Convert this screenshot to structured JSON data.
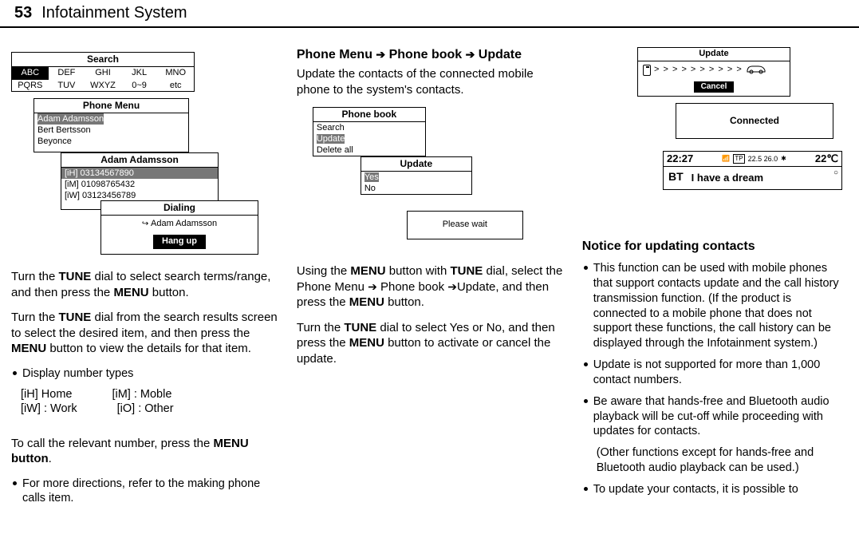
{
  "header": {
    "page_number": "53",
    "section_title": "Infotainment System"
  },
  "col1": {
    "search_screen": {
      "title": "Search",
      "row1": [
        "ABC",
        "DEF",
        "GHI",
        "JKL",
        "MNO"
      ],
      "row2": [
        "PQRS",
        "TUV",
        "WXYZ",
        "0~9",
        "etc"
      ]
    },
    "phone_menu_screen": {
      "title": "Phone Menu",
      "items": [
        "Adam Adamsson",
        "Bert Bertsson",
        "Beyonce"
      ]
    },
    "contact_screen": {
      "title": "Adam Adamsson",
      "items": [
        "[iH] 03134567890",
        "[iM] 01098765432",
        "[iW] 03123456789"
      ]
    },
    "dialing_screen": {
      "title": "Dialing",
      "name": "Adam Adamsson",
      "hangup": "Hang up"
    },
    "para1_a": "Turn the ",
    "para1_b": "TUNE",
    "para1_c": " dial to select search terms/range, and then press the ",
    "para1_d": "MENU",
    "para1_e": " button.",
    "para2_a": "Turn the ",
    "para2_b": "TUNE",
    "para2_c": " dial from the search results screen to select the desired item, and then press the ",
    "para2_d": "MENU",
    "para2_e": " button to view the details for that item.",
    "bullet1": "Display number types",
    "types": {
      "h": "[iH] Home",
      "m": "[iM] : Moble",
      "w": "[iW] : Work",
      "o": "[iO] : Other"
    },
    "para3_a": "To call the relevant number, press the ",
    "para3_b": "MENU button",
    "para3_c": ".",
    "bullet2": "For more directions, refer to the making phone calls item."
  },
  "col2": {
    "heading": {
      "a": "Phone Menu ",
      "b": " Phone book ",
      "c": " Update"
    },
    "intro": "Update the contacts of the connected mobile phone to the system's contacts.",
    "phonebook_screen": {
      "title": "Phone book",
      "items": [
        "Search",
        "Update",
        "Delete all"
      ]
    },
    "update_screen": {
      "title": "Update",
      "items": [
        "Yes",
        "No"
      ]
    },
    "wait_screen": {
      "msg": "Please wait"
    },
    "para1_a": "Using the ",
    "para1_b": "MENU",
    "para1_c": " button with ",
    "para1_d": "TUNE",
    "para1_e": " dial, select the Phone Menu ",
    "para1_f": " Phone book ",
    "para1_g": "Update, and then press the ",
    "para1_h": "MENU",
    "para1_i": " button.",
    "para2_a": "Turn the ",
    "para2_b": "TUNE",
    "para2_c": " dial to select Yes or No, and then press the ",
    "para2_d": "MENU",
    "para2_e": " button to activate or cancel the update."
  },
  "col3": {
    "update_screen": {
      "title": "Update",
      "progress": "> > > > > > > > > >",
      "cancel": "Cancel"
    },
    "connected_screen": {
      "msg": "Connected"
    },
    "nowplay_screen": {
      "time": "22:27",
      "sig": "22.5 26.0",
      "temp": "22℃",
      "bt": "BT",
      "track": "I have a dream"
    },
    "notice_heading": "Notice for updating contacts",
    "b1": "This function can be used with mobile phones that support contacts update and the call history transmission function. (If the product is connected to a mobile phone that does not support these functions, the call history can be displayed through the Infotainment system.)",
    "b2": "Update is not supported for more than 1,000 contact numbers.",
    "b3": "Be aware that hands-free and Bluetooth audio playback will be cut-off while proceeding with updates for contacts.",
    "b3_sub": "(Other functions except for hands-free and Bluetooth audio playback can be used.)",
    "b4": "To update your contacts, it is possible to"
  }
}
